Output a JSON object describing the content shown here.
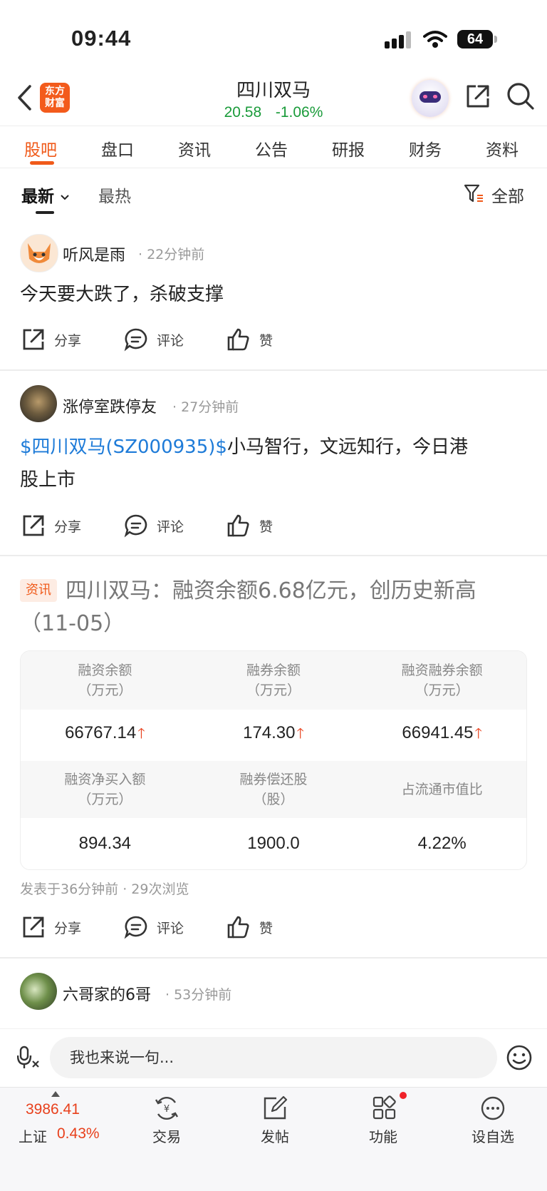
{
  "status_bar": {
    "time": "09:44",
    "battery": "64"
  },
  "header": {
    "logo_line1": "东方",
    "logo_line2": "财富",
    "stock_name": "四川双马",
    "price": "20.58",
    "change": "-1.06%"
  },
  "tabs": [
    "股吧",
    "盘口",
    "资讯",
    "公告",
    "研报",
    "财务",
    "资料"
  ],
  "filters": {
    "newest": "最新",
    "hot": "最热",
    "all": "全部"
  },
  "actions": {
    "share": "分享",
    "comment": "评论",
    "like": "赞"
  },
  "posts": [
    {
      "user": "听风是雨",
      "time": "22分钟前",
      "text": "今天要大跌了，杀破支撑"
    },
    {
      "user": "涨停室跌停友",
      "time": "27分钟前",
      "link": "$四川双马(SZ000935)$",
      "text_line1": "小马智行，文远知行，今日港",
      "text_line2": "股上市"
    },
    {
      "user": "六哥家的6哥",
      "time": "53分钟前"
    }
  ],
  "news": {
    "badge": "资讯",
    "title": "四川双马：融资余额6.68亿元，创历史新高（11-05）",
    "table": {
      "row1_headers": [
        {
          "l1": "融资余额",
          "l2": "（万元）"
        },
        {
          "l1": "融券余额",
          "l2": "（万元）"
        },
        {
          "l1": "融资融券余额",
          "l2": "（万元）"
        }
      ],
      "row1_values": [
        "66767.14",
        "174.30",
        "66941.45"
      ],
      "row2_headers": [
        {
          "l1": "融资净买入额",
          "l2": "（万元）"
        },
        {
          "l1": "融券偿还股",
          "l2": "（股）"
        },
        {
          "l1": "占流通市值比",
          "l2": ""
        }
      ],
      "row2_values": [
        "894.34",
        "1900.0",
        "4.22%"
      ]
    },
    "meta": "发表于36分钟前 · 29次浏览"
  },
  "comment_bar": {
    "placeholder": "我也来说一句..."
  },
  "bottom_nav": {
    "index_value": "3986.41",
    "index_name": "上证",
    "index_change": "0.43%",
    "items": [
      "交易",
      "发帖",
      "功能",
      "设自选"
    ]
  },
  "colors": {
    "accent": "#f05a1a",
    "up": "#e8401c",
    "down": "#1a9b3a",
    "link": "#1e7bd8"
  }
}
